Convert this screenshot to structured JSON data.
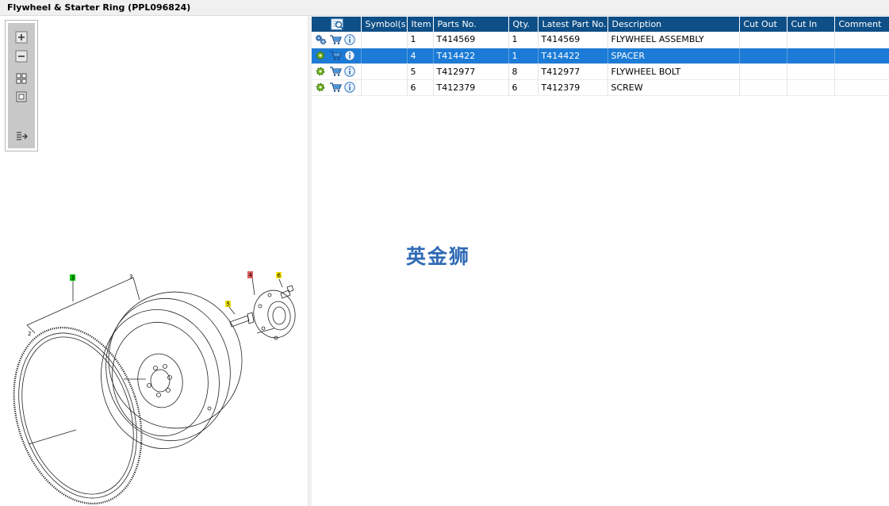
{
  "window": {
    "title": "Flywheel & Starter Ring (PPL096824)"
  },
  "toolbar": {
    "buttons": [
      {
        "name": "zoom-in-icon"
      },
      {
        "name": "zoom-out-icon"
      },
      {
        "name": "fit-grid-icon"
      },
      {
        "name": "actual-size-icon"
      },
      {
        "name": "list-export-icon"
      }
    ]
  },
  "drawing": {
    "callouts": [
      {
        "label": "3",
        "color": "#00c000"
      },
      {
        "label": "3"
      },
      {
        "label": "4",
        "color": "#e06060"
      },
      {
        "label": "6",
        "color": "#f0e000"
      },
      {
        "label": "5",
        "color": "#f0e000"
      },
      {
        "label": "2"
      }
    ]
  },
  "table": {
    "columns": [
      "Symbol(s)",
      "Item",
      "Parts No.",
      "Qty.",
      "Latest Part No.",
      "Description",
      "Cut Out",
      "Cut In",
      "Comment"
    ],
    "rows": [
      {
        "item": "1",
        "parts_no": "T414569",
        "qty": "1",
        "latest": "T414569",
        "description": "FLYWHEEL ASSEMBLY",
        "cut_out": "",
        "cut_in": "",
        "comment": "",
        "selected": false
      },
      {
        "item": "4",
        "parts_no": "T414422",
        "qty": "1",
        "latest": "T414422",
        "description": "SPACER",
        "cut_out": "",
        "cut_in": "",
        "comment": "",
        "selected": true
      },
      {
        "item": "5",
        "parts_no": "T412977",
        "qty": "8",
        "latest": "T412977",
        "description": "FLYWHEEL BOLT",
        "cut_out": "",
        "cut_in": "",
        "comment": "",
        "selected": false
      },
      {
        "item": "6",
        "parts_no": "T412379",
        "qty": "6",
        "latest": "T412379",
        "description": "SCREW",
        "cut_out": "",
        "cut_in": "",
        "comment": "",
        "selected": false
      }
    ]
  },
  "watermark": "英金狮",
  "colors": {
    "header": "#0e4f87",
    "selection": "#1b7bd6",
    "watermark": "#2f6ab5"
  }
}
